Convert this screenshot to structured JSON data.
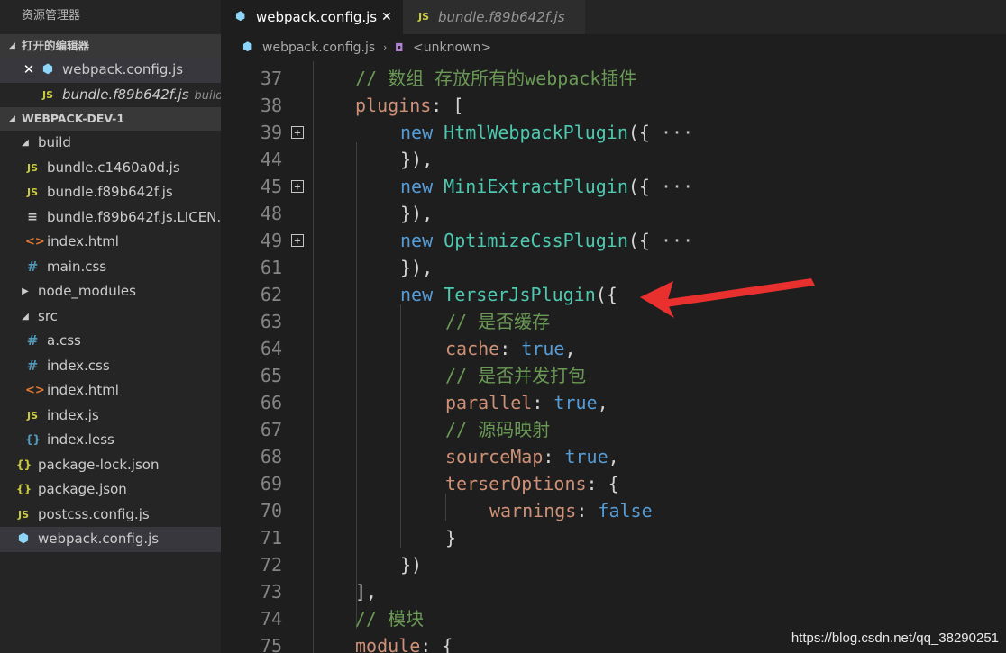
{
  "sidebar": {
    "title": "资源管理器",
    "open_editors": {
      "header": "打开的编辑器",
      "items": [
        {
          "name": "webpack.config.js",
          "close": "✕"
        },
        {
          "name": "bundle.f89b642f.js",
          "desc": "build"
        }
      ]
    },
    "project": {
      "header": "WEBPACK-DEV-1",
      "tree": [
        {
          "label": "build"
        },
        {
          "label": "bundle.c1460a0d.js"
        },
        {
          "label": "bundle.f89b642f.js"
        },
        {
          "label": "bundle.f89b642f.js.LICEN..."
        },
        {
          "label": "index.html"
        },
        {
          "label": "main.css"
        },
        {
          "label": "node_modules"
        },
        {
          "label": "src"
        },
        {
          "label": "a.css"
        },
        {
          "label": "index.css"
        },
        {
          "label": "index.html"
        },
        {
          "label": "index.js"
        },
        {
          "label": "index.less"
        },
        {
          "label": "package-lock.json"
        },
        {
          "label": "package.json"
        },
        {
          "label": "postcss.config.js"
        },
        {
          "label": "webpack.config.js"
        }
      ]
    }
  },
  "tabs": [
    {
      "label": "webpack.config.js",
      "close": "✕"
    },
    {
      "label": "bundle.f89b642f.js"
    }
  ],
  "breadcrumb": {
    "file": "webpack.config.js",
    "symbol": "<unknown>"
  },
  "editor": {
    "line_numbers": [
      "37",
      "38",
      "39",
      "44",
      "45",
      "48",
      "49",
      "61",
      "62",
      "63",
      "64",
      "65",
      "66",
      "67",
      "68",
      "69",
      "70",
      "71",
      "72",
      "73",
      "74",
      "75"
    ],
    "lines": {
      "l37": {
        "comment": "// 数组 存放所有的webpack插件"
      },
      "l38": {
        "prop": "plugins",
        "rest": ": ["
      },
      "l39": {
        "kw": "new",
        "cls": "HtmlWebpackPlugin",
        "br": "({",
        "ell": "···"
      },
      "l44": {
        "br": "}),"
      },
      "l45": {
        "kw": "new",
        "cls": "MiniExtractPlugin",
        "br": "({",
        "ell": "···"
      },
      "l48": {
        "br": "}),"
      },
      "l49": {
        "kw": "new",
        "cls": "OptimizeCssPlugin",
        "br": "({",
        "ell": "···"
      },
      "l61": {
        "br": "}),"
      },
      "l62": {
        "kw": "new",
        "cls": "TerserJsPlugin",
        "br": "({"
      },
      "l63": {
        "comment": "// 是否缓存"
      },
      "l64": {
        "prop": "cache",
        "colon": ": ",
        "val": "true",
        "tail": ","
      },
      "l65": {
        "comment": "// 是否并发打包"
      },
      "l66": {
        "prop": "parallel",
        "colon": ": ",
        "val": "true",
        "tail": ","
      },
      "l67": {
        "comment": "// 源码映射"
      },
      "l68": {
        "prop": "sourceMap",
        "colon": ": ",
        "val": "true",
        "tail": ","
      },
      "l69": {
        "prop": "terserOptions",
        "rest": ": {"
      },
      "l70": {
        "prop": "warnings",
        "colon": ": ",
        "val": "false"
      },
      "l71": {
        "br": "}"
      },
      "l72": {
        "br": "})"
      },
      "l73": {
        "br": "],"
      },
      "l74": {
        "comment": "// 模块"
      },
      "l75": {
        "prop": "module",
        "rest": ": {"
      }
    }
  },
  "watermark": "https://blog.csdn.net/qq_38290251",
  "colors": {
    "background": "#1e1e1e",
    "sidebar": "#252526",
    "comment": "#6a9955",
    "keyword": "#569cd6",
    "class": "#4ec9b0",
    "property": "#ce9178",
    "annotation_arrow": "#e8312f"
  }
}
